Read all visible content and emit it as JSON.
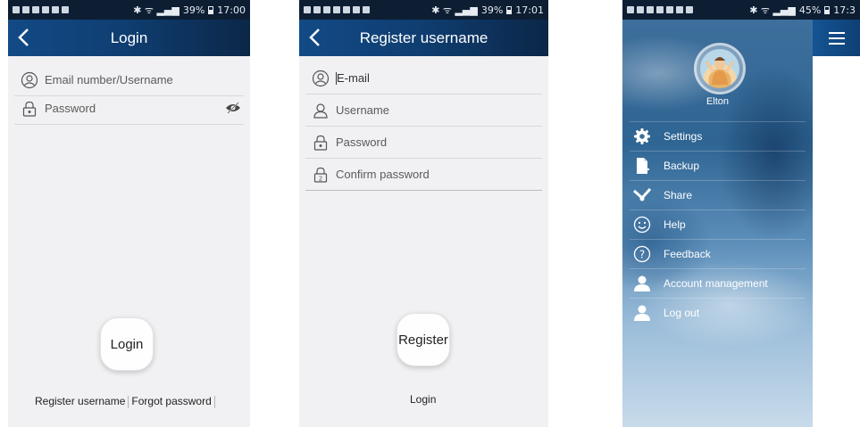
{
  "login_screen": {
    "status": {
      "battery": "39%",
      "time": "17:00"
    },
    "title": "Login",
    "fields": [
      {
        "placeholder": "Email number/Username",
        "icon": "user-circle-icon"
      },
      {
        "placeholder": "Password",
        "icon": "lock-icon"
      }
    ],
    "login_button": "Login",
    "register_link": "Register username",
    "forgot_link": "Forgot password"
  },
  "register_screen": {
    "status": {
      "battery": "39%",
      "time": "17:01"
    },
    "title": "Register username",
    "fields": [
      {
        "placeholder": "E-mail",
        "icon": "user-circle-icon"
      },
      {
        "placeholder": "Username",
        "icon": "person-icon"
      },
      {
        "placeholder": "Password",
        "icon": "lock-icon"
      },
      {
        "placeholder": "Confirm password",
        "icon": "lock-2-icon"
      }
    ],
    "register_button": "Register",
    "login_link": "Login"
  },
  "drawer_screen": {
    "status": {
      "battery": "45%",
      "time": "17:3"
    },
    "user": {
      "name": "Elton"
    },
    "menu": [
      {
        "label": "Settings",
        "icon": "gear-icon"
      },
      {
        "label": "Backup",
        "icon": "document-icon"
      },
      {
        "label": "Share",
        "icon": "share-icon"
      },
      {
        "label": "Help",
        "icon": "smiley-icon"
      },
      {
        "label": "Feedback",
        "icon": "question-icon"
      },
      {
        "label": "Account management",
        "icon": "person-icon"
      },
      {
        "label": "Log out",
        "icon": "person-icon"
      }
    ]
  }
}
